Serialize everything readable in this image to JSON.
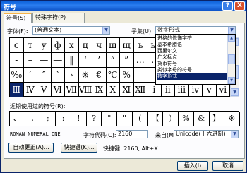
{
  "window": {
    "title": "符号",
    "help_label": "?",
    "close_label": "X"
  },
  "tabs": [
    {
      "label": "符号(S)"
    },
    {
      "label": "特殊字符(P)"
    }
  ],
  "font": {
    "label": "字体(F):",
    "value": "(普通文本)"
  },
  "subset": {
    "label": "子集(U):",
    "value": "数字形式"
  },
  "subset_options": [
    "进格的修饰字符",
    "基本希腊语",
    "西里尔文",
    "广义标点",
    "货币符号",
    "类似字母的符号",
    "数字形式"
  ],
  "grid_rows": [
    [
      "с",
      "т",
      "у",
      "ф",
      "х",
      "ц",
      "ч",
      "ш",
      "щ",
      "ъ",
      "ы",
      "",
      "",
      "",
      "",
      ""
    ],
    [
      "‐",
      "–",
      "—",
      "―",
      "‖",
      "‘",
      "’",
      "“",
      "”",
      "…",
      "‥",
      "",
      "",
      "",
      "",
      ""
    ],
    [
      "‰",
      "′",
      "″",
      "‵",
      "›",
      "※",
      "€",
      "℃",
      "%",
      "",
      "",
      "",
      "",
      "",
      "",
      ""
    ],
    [
      "Ⅲ",
      "Ⅳ",
      "Ⅴ",
      "Ⅵ",
      "Ⅶ",
      "Ⅷ",
      "Ⅸ",
      "Ⅹ",
      "Ⅺ",
      "Ⅻ",
      "ⅰ",
      "ⅱ",
      "ⅲ",
      "ⅳ",
      "ⅴ",
      "ⅵ"
    ]
  ],
  "recent": {
    "label": "近期使用过的符号(R):",
    "items": [
      "、",
      ",",
      ";",
      ":",
      "!",
      "?",
      "\"",
      "\"",
      "(",
      "【",
      ")",
      "%",
      "&",
      "】",
      "※"
    ]
  },
  "char_name": "ROMAN NUMERAL ONE",
  "char_code": {
    "label": "字符代码(C):",
    "value": "2160"
  },
  "from": {
    "label": "来自(M):",
    "value": "Unicode(十六进制)"
  },
  "buttons": {
    "autocorrect": "自动更正(A)...",
    "shortcut": "快捷键(K)...",
    "shortcut_info": "快捷键: 2160, Alt+X",
    "insert": "插入(I)",
    "cancel": "取消"
  }
}
